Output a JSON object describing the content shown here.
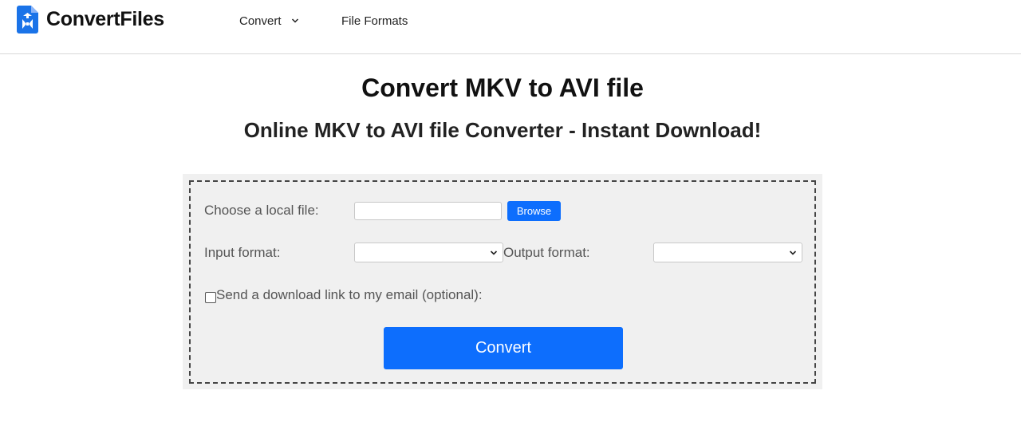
{
  "header": {
    "logo_text": "ConvertFiles",
    "nav": {
      "convert_label": "Convert",
      "formats_label": "File Formats"
    }
  },
  "main": {
    "title": "Convert MKV to AVI file",
    "subtitle": "Online MKV to AVI file Converter - Instant Download!"
  },
  "form": {
    "choose_file_label": "Choose a local file:",
    "file_input_value": "",
    "browse_label": "Browse",
    "input_format_label": "Input format:",
    "input_format_value": "",
    "output_format_label": "Output format:",
    "output_format_value": "",
    "email_checkbox_checked": false,
    "email_label": "Send a download link to my email (optional):",
    "convert_label": "Convert"
  },
  "colors": {
    "accent": "#0d6efd",
    "panel_bg": "#f0f0f0",
    "logo_blue": "#1a73e8"
  },
  "icons": {
    "logo": "convertfiles-logo-icon",
    "nav_dropdown": "chevron-down-icon",
    "select_dropdown": "chevron-down-icon"
  }
}
